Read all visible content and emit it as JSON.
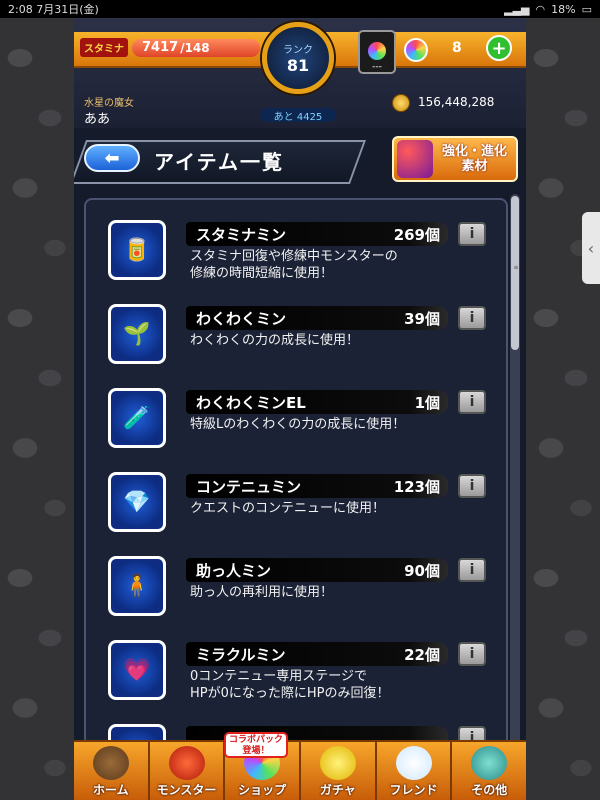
{
  "status_bar": {
    "time_date": "2:08  7月31日(金)",
    "battery": "18%"
  },
  "hud": {
    "stamina_label": "スタミナ",
    "stamina_current": "7417",
    "stamina_max": "/148",
    "rank_label": "ランク",
    "rank_value": "81",
    "exp_to_next": "あと 4425",
    "slot_value": "---",
    "orb_count": "8",
    "guild_name": "水星の魔女",
    "player_name": "ああ",
    "gold": "156,448,288"
  },
  "header": {
    "title": "アイテム一覧",
    "evo_button_line1": "強化・進化",
    "evo_button_line2": "素材"
  },
  "items": [
    {
      "name": "スタミナミン",
      "count": "269個",
      "desc": "スタミナ回復や修練中モンスターの\n修練の時間短縮に使用！",
      "icon": "can-icon"
    },
    {
      "name": "わくわくミン",
      "count": "39個",
      "desc": "わくわくの力の成長に使用！",
      "icon": "sprout-bottle-icon"
    },
    {
      "name": "わくわくミンEL",
      "count": "1個",
      "desc": "特級Lのわくわくの力の成長に使用！",
      "icon": "sprout-bottle-el-icon"
    },
    {
      "name": "コンテニュミン",
      "count": "123個",
      "desc": "クエストのコンテニューに使用！",
      "icon": "crystal-flask-icon"
    },
    {
      "name": "助っ人ミン",
      "count": "90個",
      "desc": "助っ人の再利用に使用！",
      "icon": "figure-icon"
    },
    {
      "name": "ミラクルミン",
      "count": "22個",
      "desc": "0コンテニュー専用ステージで\nHPが0になった際にHPのみ回復！",
      "icon": "heart-flask-icon"
    }
  ],
  "tabbar": {
    "home": "ホーム",
    "monster": "モンスター",
    "shop": "ショップ",
    "gacha": "ガチャ",
    "friend": "フレンド",
    "other": "その他",
    "shop_badge": "コラボパック\n登場！"
  },
  "colors": {
    "accent_orange": "#f7a62b",
    "rank_ring": "#e6a017",
    "panel_bg": "#1b2236"
  }
}
